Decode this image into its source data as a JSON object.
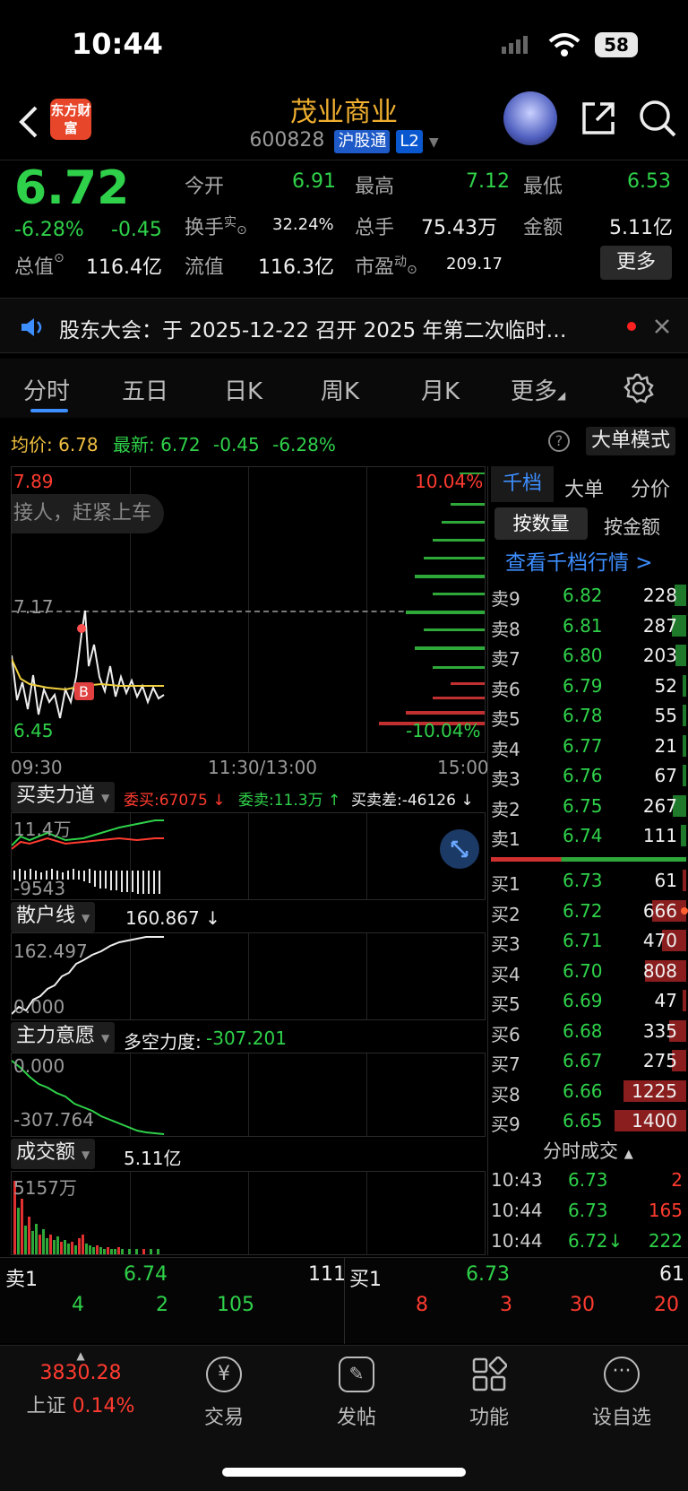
{
  "status_bar": {
    "time": "10:44",
    "battery": "58"
  },
  "header": {
    "back_label": "<",
    "logo_text": "东方财富",
    "title": "茂业商业",
    "code": "600828",
    "market_tag": "沪股通",
    "level_tag": "L2"
  },
  "quote": {
    "price": "6.72",
    "change_pct": "-6.28%",
    "change": "-0.45",
    "open_label": "今开",
    "open": "6.91",
    "high_label": "最高",
    "high": "7.12",
    "low_label": "最低",
    "low": "6.53",
    "turnover_label": "换手",
    "turnover_sup": "实",
    "turnover": "32.24%",
    "volume_label": "总手",
    "volume": "75.43万",
    "amount_label": "金额",
    "amount": "5.11亿",
    "mktcap_label": "总值",
    "mktcap": "116.4亿",
    "float_label": "流值",
    "float_cap": "116.3亿",
    "pe_label": "市盈",
    "pe_sup": "动",
    "pe": "209.17",
    "more_button": "更多"
  },
  "notice": {
    "text": "股东大会：于 2025-12-22 召开 2025 年第二次临时…"
  },
  "tabs": [
    "分时",
    "五日",
    "日K",
    "周K",
    "月K",
    "更多"
  ],
  "intraday": {
    "avg_label": "均价:",
    "avg": "6.78",
    "latest_label": "最新:",
    "latest": "6.72",
    "latest_change": "-0.45",
    "latest_pct": "-6.28%",
    "big_order_mode": "大单模式",
    "y_top": "7.89",
    "y_mid": "7.17",
    "y_bottom": "6.45",
    "pct_top": "10.04%",
    "pct_bottom": "-10.04%",
    "banner": "接人，赶紧上车",
    "marker": "B",
    "t_start": "09:30",
    "t_mid": "11:30/13:00",
    "t_end": "15:00"
  },
  "indicator1": {
    "name": "买卖力道",
    "wb_label": "委买:67075 ↓",
    "ws_label": "委卖:11.3万 ↑",
    "diff_label": "买卖差:-46126 ↓",
    "y_top": "11.4万",
    "y_bottom": "-9543"
  },
  "indicator2": {
    "name": "散户线",
    "value": "160.867 ↓",
    "y_top": "162.497",
    "y_bottom": "0.000"
  },
  "indicator3": {
    "name": "主力意愿",
    "value_label": "多空力度:",
    "value": "-307.201",
    "y_top": "0.000",
    "y_bottom": "-307.764"
  },
  "indicator4": {
    "name": "成交额",
    "value": "5.11亿",
    "y_top": "5157万"
  },
  "book_tabs": [
    "千档",
    "大单",
    "分价"
  ],
  "book_subtabs": [
    "按数量",
    "按金额"
  ],
  "book_link": "查看千档行情 >",
  "asks": [
    {
      "label": "卖9",
      "price": "6.82",
      "vol": "228"
    },
    {
      "label": "卖8",
      "price": "6.81",
      "vol": "287"
    },
    {
      "label": "卖7",
      "price": "6.80",
      "vol": "203"
    },
    {
      "label": "卖6",
      "price": "6.79",
      "vol": "52"
    },
    {
      "label": "卖5",
      "price": "6.78",
      "vol": "55"
    },
    {
      "label": "卖4",
      "price": "6.77",
      "vol": "21"
    },
    {
      "label": "卖3",
      "price": "6.76",
      "vol": "67"
    },
    {
      "label": "卖2",
      "price": "6.75",
      "vol": "267"
    },
    {
      "label": "卖1",
      "price": "6.74",
      "vol": "111"
    }
  ],
  "bids": [
    {
      "label": "买1",
      "price": "6.73",
      "vol": "61"
    },
    {
      "label": "买2",
      "price": "6.72",
      "vol": "666"
    },
    {
      "label": "买3",
      "price": "6.71",
      "vol": "470"
    },
    {
      "label": "买4",
      "price": "6.70",
      "vol": "808"
    },
    {
      "label": "买5",
      "price": "6.69",
      "vol": "47"
    },
    {
      "label": "买6",
      "price": "6.68",
      "vol": "335"
    },
    {
      "label": "买7",
      "price": "6.67",
      "vol": "275"
    },
    {
      "label": "买8",
      "price": "6.66",
      "vol": "1225"
    },
    {
      "label": "买9",
      "price": "6.65",
      "vol": "1400"
    }
  ],
  "trades_title": "分时成交",
  "trades": [
    {
      "time": "10:43",
      "price": "6.73",
      "vol": "2"
    },
    {
      "time": "10:44",
      "price": "6.73",
      "vol": "165"
    },
    {
      "time": "10:44",
      "price": "6.72↓",
      "vol": "222"
    }
  ],
  "bottom_quote": {
    "sell1_label": "卖1",
    "sell1_price": "6.74",
    "sell1_vol": "111",
    "buy1_label": "买1",
    "buy1_price": "6.73",
    "buy1_vol": "61",
    "sell_q": [
      "4",
      "2",
      "105"
    ],
    "buy_q": [
      "8",
      "3",
      "30",
      "20"
    ]
  },
  "nav": {
    "index_value": "3830.28",
    "index_name": "上证",
    "index_pct": "0.14%",
    "items": [
      "交易",
      "发帖",
      "功能",
      "设自选"
    ]
  }
}
